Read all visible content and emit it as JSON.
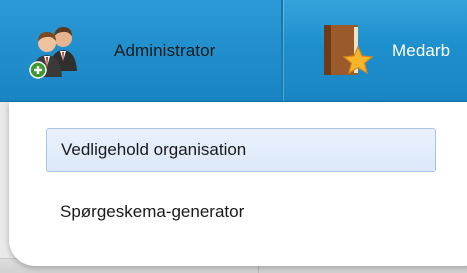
{
  "navbar": {
    "items": [
      {
        "label": "Administrator",
        "icon": "users-add-icon"
      },
      {
        "label": "Medarb",
        "icon": "book-star-icon"
      }
    ]
  },
  "dropdown": {
    "items": [
      {
        "label": "Vedligehold organisation",
        "active": true
      },
      {
        "label": "Spørgeskema-generator",
        "active": false
      }
    ]
  },
  "colors": {
    "navbar": "#1d8fcc",
    "active_item_bg": "#dce8f8",
    "active_item_border": "#a9c4e6"
  }
}
